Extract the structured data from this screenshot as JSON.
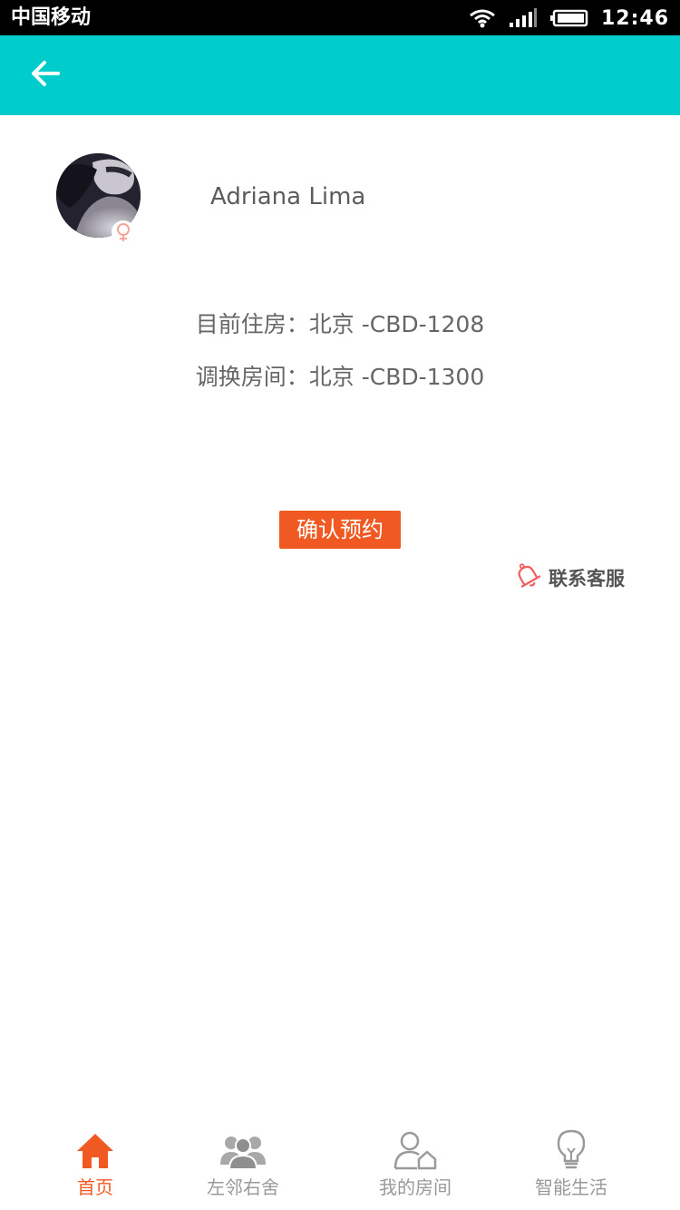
{
  "status_bar": {
    "carrier": "中国移动",
    "time": "12:46"
  },
  "header": {
    "back_icon": "arrow-left-icon"
  },
  "profile": {
    "name": "Adriana Lima",
    "gender_icon": "female-symbol-icon"
  },
  "room_info": {
    "current_label": "目前住房：",
    "current_value": "北京 -CBD-1208",
    "swap_label": "调换房间：",
    "swap_value": "北京 -CBD-1300"
  },
  "actions": {
    "confirm_label": "确认预约",
    "contact_label": "联系客服",
    "contact_icon": "bell-icon"
  },
  "bottom_nav": {
    "items": [
      {
        "label": "首页",
        "icon": "home-icon",
        "active": true
      },
      {
        "label": "左邻右舍",
        "icon": "people-icon",
        "active": false
      },
      {
        "label": "我的房间",
        "icon": "user-house-icon",
        "active": false
      },
      {
        "label": "智能生活",
        "icon": "lightbulb-icon",
        "active": false
      }
    ]
  },
  "colors": {
    "header": "#00cccc",
    "accent": "#f05a22",
    "nav_inactive": "#999999",
    "text": "#666666"
  }
}
